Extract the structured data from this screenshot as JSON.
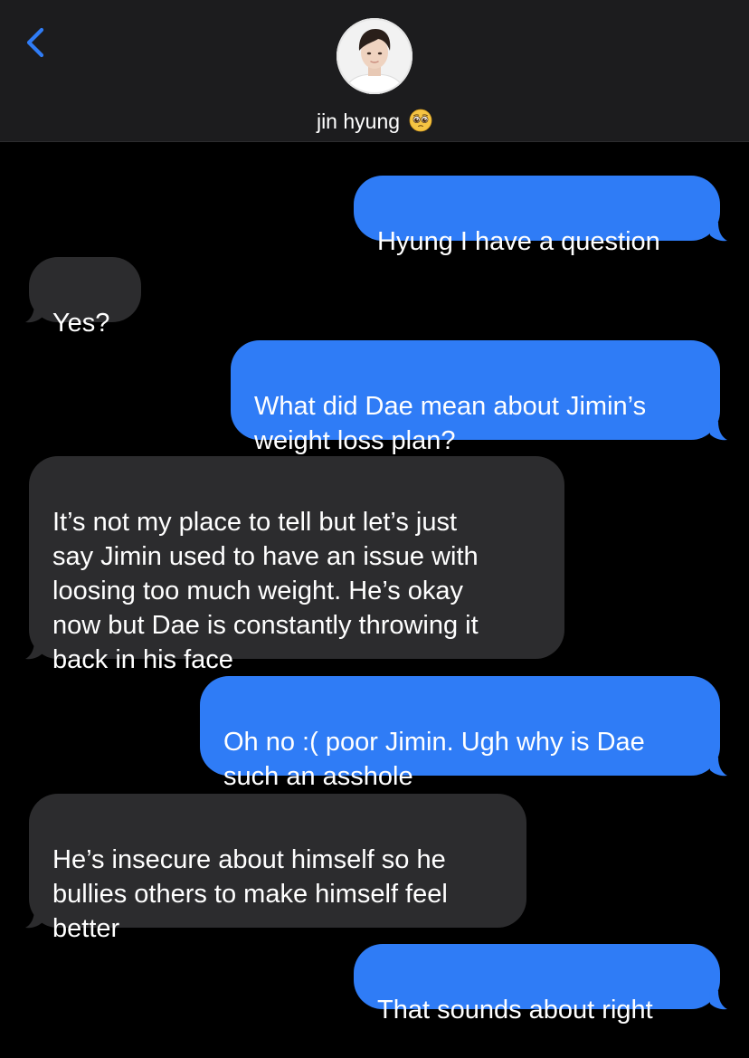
{
  "header": {
    "back_icon": "chevron-left-icon",
    "contact_name": "jin hyung",
    "contact_emoji": "pleading-face-emoji",
    "avatar": "contact-avatar-photo"
  },
  "colors": {
    "sent_bubble": "#2f7cf6",
    "received_bubble": "#2c2c2e",
    "accent": "#2f7cf6",
    "background": "#000000",
    "header_background": "#1c1c1e"
  },
  "messages": [
    {
      "direction": "sent",
      "text": "Hyung I have a question"
    },
    {
      "direction": "received",
      "text": "Yes?"
    },
    {
      "direction": "sent",
      "text": "What did Dae mean about Jimin’s\nweight loss plan?"
    },
    {
      "direction": "received",
      "text": "It’s not my place to tell but let’s just\nsay Jimin used to have an issue with\nloosing too much weight. He’s okay\nnow but Dae is constantly throwing it\nback in his face"
    },
    {
      "direction": "sent",
      "text": "Oh no :( poor Jimin. Ugh why is Dae\nsuch an asshole"
    },
    {
      "direction": "received",
      "text": "He’s insecure about himself so he\nbullies others to make himself feel\nbetter"
    },
    {
      "direction": "sent",
      "text": "That sounds about right"
    }
  ]
}
